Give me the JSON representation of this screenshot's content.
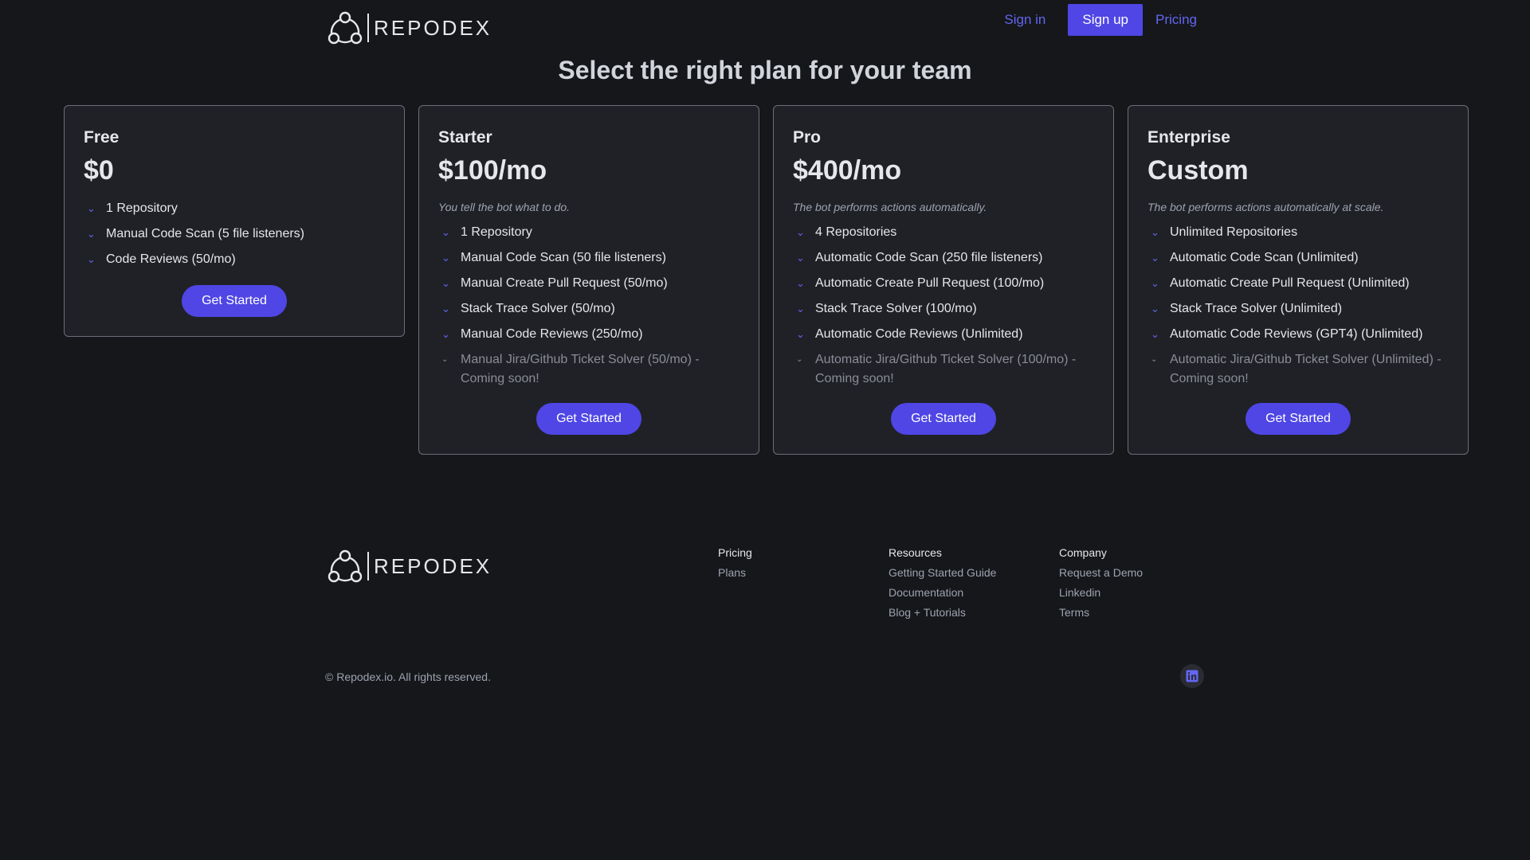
{
  "brand": {
    "name": "REPODEX",
    "logo_icon": "repodex-logo-icon"
  },
  "nav": {
    "sign_in": "Sign in",
    "sign_up": "Sign up",
    "pricing": "Pricing"
  },
  "page": {
    "title": "Select the right plan for your team"
  },
  "colors": {
    "accent": "#4f46e5",
    "link": "#6366f1",
    "background": "#16171b",
    "card": "#202127"
  },
  "plans": [
    {
      "name": "Free",
      "price": "$0",
      "description": "",
      "features": [
        "1 Repository",
        "Manual Code Scan (5 file listeners)",
        "Code Reviews (50/mo)"
      ],
      "coming_soon": "",
      "cta": "Get Started"
    },
    {
      "name": "Starter",
      "price": "$100/mo",
      "description": "You tell the bot what to do.",
      "features": [
        "1 Repository",
        "Manual Code Scan (50 file listeners)",
        "Manual Create Pull Request (50/mo)",
        "Stack Trace Solver (50/mo)",
        "Manual Code Reviews (250/mo)"
      ],
      "coming_soon": "Manual Jira/Github Ticket Solver (50/mo) - Coming soon!",
      "cta": "Get Started"
    },
    {
      "name": "Pro",
      "price": "$400/mo",
      "description": "The bot performs actions automatically.",
      "features": [
        "4 Repositories",
        "Automatic Code Scan (250 file listeners)",
        "Automatic Create Pull Request (100/mo)",
        "Stack Trace Solver (100/mo)",
        "Automatic Code Reviews (Unlimited)"
      ],
      "coming_soon": "Automatic Jira/Github Ticket Solver (100/mo) - Coming soon!",
      "cta": "Get Started"
    },
    {
      "name": "Enterprise",
      "price": "Custom",
      "description": "The bot performs actions automatically at scale.",
      "features": [
        "Unlimited Repositories",
        "Automatic Code Scan (Unlimited)",
        "Automatic Create Pull Request (Unlimited)",
        "Stack Trace Solver (Unlimited)",
        "Automatic Code Reviews (GPT4) (Unlimited)"
      ],
      "coming_soon": "Automatic Jira/Github Ticket Solver (Unlimited) - Coming soon!",
      "cta": "Get Started"
    }
  ],
  "footer": {
    "columns": [
      {
        "heading": "Pricing",
        "links": [
          "Plans"
        ]
      },
      {
        "heading": "Resources",
        "links": [
          "Getting Started Guide",
          "Documentation",
          "Blog + Tutorials"
        ]
      },
      {
        "heading": "Company",
        "links": [
          "Request a Demo",
          "Linkedin",
          "Terms"
        ]
      }
    ],
    "copyright": "© Repodex.io. All rights reserved.",
    "social_icon": "linkedin-icon"
  }
}
